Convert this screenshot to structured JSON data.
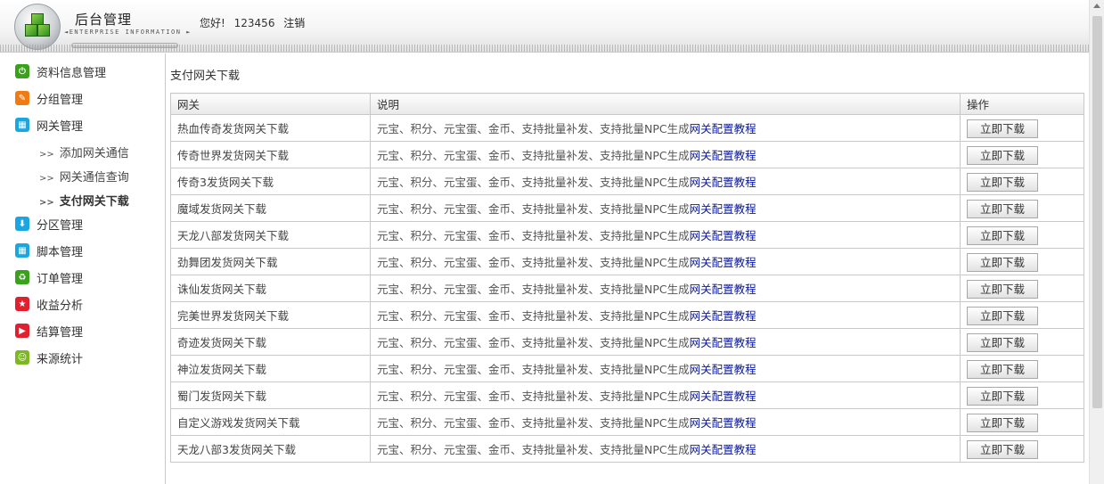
{
  "header": {
    "logo_title": "后台管理",
    "logo_sub": "◄ENTERPRISE INFORMATION ►",
    "greeting": "您好!",
    "username": "123456",
    "logout": "注销"
  },
  "sidebar": {
    "items": [
      {
        "label": "资料信息管理",
        "icon": "power-icon",
        "color": "#3aa21a"
      },
      {
        "label": "分组管理",
        "icon": "pencil-icon",
        "color": "#f07b14"
      },
      {
        "label": "网关管理",
        "icon": "grid-icon",
        "color": "#1aa6e0"
      },
      {
        "label": "分区管理",
        "icon": "download-icon",
        "color": "#1aa6e0"
      },
      {
        "label": "脚本管理",
        "icon": "grid-icon",
        "color": "#1aa6e0"
      },
      {
        "label": "订单管理",
        "icon": "recycle-icon",
        "color": "#3aa21a"
      },
      {
        "label": "收益分析",
        "icon": "star-icon",
        "color": "#e0202e"
      },
      {
        "label": "结算管理",
        "icon": "play-icon",
        "color": "#e0202e"
      },
      {
        "label": "来源统计",
        "icon": "smile-icon",
        "color": "#7cb820"
      }
    ],
    "sub_items": [
      {
        "label": "添加网关通信",
        "prefix": ">>"
      },
      {
        "label": "网关通信查询",
        "prefix": ">>"
      },
      {
        "label": "支付网关下载",
        "prefix": ">>",
        "active": true
      }
    ]
  },
  "main": {
    "title": "支付网关下载",
    "columns": [
      "网关",
      "说明",
      "操作"
    ],
    "desc_text": "元宝、积分、元宝蛋、金币、支持批量补发、支持批量NPC生成",
    "desc_link": "网关配置教程",
    "button_label": "立即下载",
    "rows": [
      "热血传奇发货网关下载",
      "传奇世界发货网关下载",
      "传奇3发货网关下载",
      "魔域发货网关下载",
      "天龙八部发货网关下载",
      "劲舞团发货网关下载",
      "诛仙发货网关下载",
      "完美世界发货网关下载",
      "奇迹发货网关下载",
      "神泣发货网关下载",
      "蜀门发货网关下载",
      "自定义游戏发货网关下载",
      "天龙八部3发货网关下载"
    ]
  },
  "colors": {
    "link": "#0a18a0",
    "border": "#c8c8c8"
  }
}
